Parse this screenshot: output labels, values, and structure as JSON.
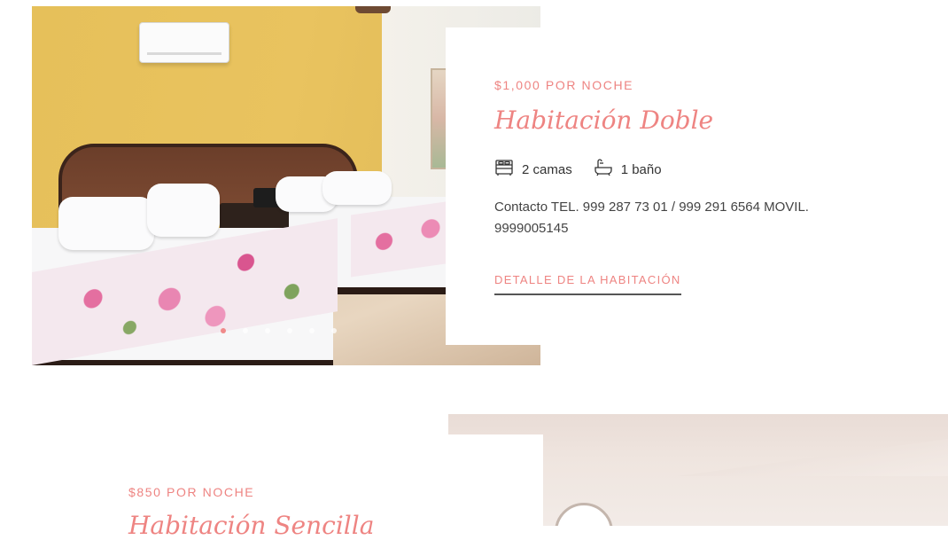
{
  "room1": {
    "price": "$1,000 POR NOCHE",
    "title": "Habitación Doble",
    "amenities": [
      {
        "icon": "bed-icon",
        "label": "2 camas"
      },
      {
        "icon": "bathtub-icon",
        "label": "1 baño"
      }
    ],
    "contact": "Contacto TEL. 999 287 73 01  / 999 291 6564 MOVIL. 9999005145",
    "detail_link": "DETALLE DE LA HABITACIÓN",
    "slider": {
      "dot_count": 6,
      "active_index": 0
    }
  },
  "room2": {
    "price": "$850 POR NOCHE",
    "title": "Habitación Sencilla"
  },
  "colors": {
    "accent": "#ee8482",
    "text": "#444444",
    "underline": "#555555"
  }
}
